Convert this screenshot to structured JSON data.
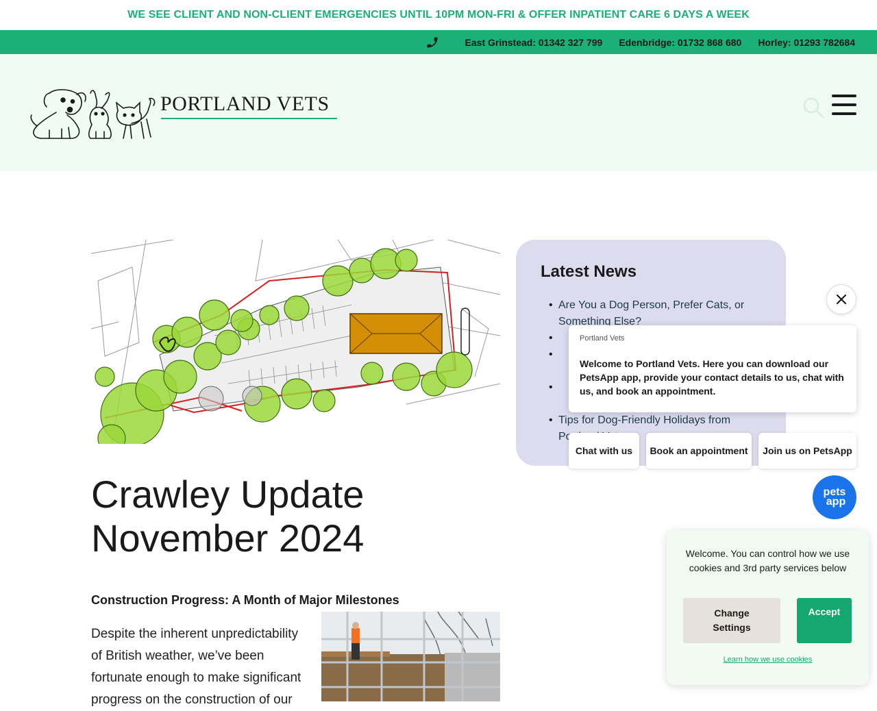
{
  "announcement": "WE SEE CLIENT AND NON-CLIENT EMERGENCIES UNTIL 10PM MON-FRI & OFFER INPATIENT CARE 6 DAYS A WEEK",
  "phones": [
    "East Grinstead: 01342 327 799",
    "Edenbridge: 01732 868 680",
    "Horley: 01293 782684"
  ],
  "brand": {
    "name": "PORTLAND VETS"
  },
  "news": {
    "title": "Latest News",
    "items": [
      "Are You a Dog Person, Prefer Cats, or Something Else?",
      "",
      "",
      "",
      "Tips for Dog-Friendly Holidays from Portland Vets"
    ]
  },
  "article": {
    "title_line1": "Crawley Update",
    "title_line2": "November 2024",
    "heading": "Construction Progress: A Month of Major Milestones",
    "body": "Despite the inherent unpredictability of British weather, we’ve been fortunate enough to make significant progress on the construction of our"
  },
  "chat": {
    "from": "Portland Vets",
    "message": "Welcome to Portland Vets. Here you can download our PetsApp app, provide your contact details to us, chat with us, and book an appointment.",
    "buttons": [
      "Chat with us",
      "Book an appointment",
      "Join us on PetsApp"
    ],
    "app_line1": "pets",
    "app_line2": "app"
  },
  "cookie": {
    "message": "Welcome. You can control how we use cookies and 3rd party services below",
    "change_label": "Change Settings",
    "accept_label": "Accept",
    "learn_label": "Learn how we use cookies"
  },
  "colors": {
    "brand_green": "#1bb077",
    "header_bg": "#f0fbf4",
    "news_card_bg": "#dcdcee",
    "app_blue": "#1a73e8"
  },
  "icons": [
    "phone-icon",
    "search-icon",
    "menu-icon",
    "close-icon"
  ]
}
